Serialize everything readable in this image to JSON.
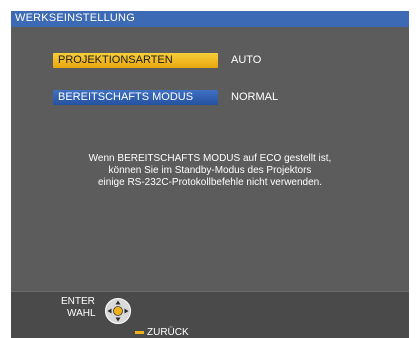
{
  "window": {
    "title": "WERKSEINSTELLUNG"
  },
  "menu": {
    "items": [
      {
        "label": "PROJEKTIONSARTEN",
        "value": "AUTO",
        "selected": true
      },
      {
        "label": "BEREITSCHAFTS MODUS",
        "value": "NORMAL",
        "selected": false
      }
    ]
  },
  "message": {
    "lines": [
      "Wenn BEREITSCHAFTS MODUS auf ECO gestellt ist,",
      "können Sie im Standby-Modus des Projektors",
      "einige  RS-232C-Protokollbefehle nicht verwenden."
    ]
  },
  "footer": {
    "enter_label": "ENTER",
    "select_label": "WAHL",
    "back_label": "ZURÜCK"
  },
  "colors": {
    "title_bar": "#3d6ab5",
    "panel": "#5c5c5c",
    "selected_item": "#f0b21a",
    "normal_item": "#2f5fb0",
    "dpad_accent": "#f0b21a"
  },
  "icons": {
    "dpad": "dpad-icon",
    "return": "return-icon"
  }
}
